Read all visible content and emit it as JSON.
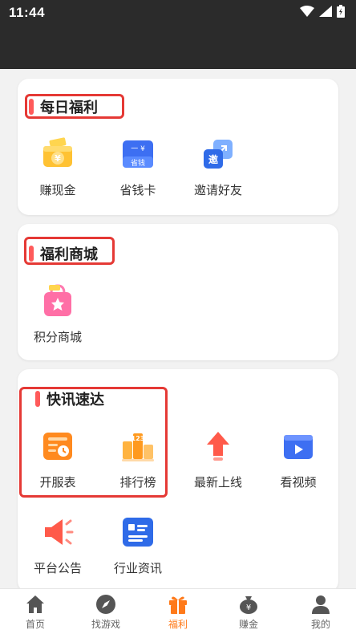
{
  "status_bar": {
    "time": "11:44"
  },
  "sections": [
    {
      "title": "每日福利",
      "items": [
        "赚现金",
        "省钱卡",
        "邀请好友"
      ]
    },
    {
      "title": "福利商城",
      "items": [
        "积分商城"
      ]
    },
    {
      "title": "快讯速达",
      "items": [
        "开服表",
        "排行榜",
        "最新上线",
        "看视频",
        "平台公告",
        "行业资讯"
      ]
    }
  ],
  "icon_text": {
    "cash": "¥",
    "card_top": "一 ¥",
    "card_bottom": "省钱",
    "invite": "邀",
    "rank": "123"
  },
  "tabs": [
    {
      "label": "首页",
      "icon": "home-icon"
    },
    {
      "label": "找游戏",
      "icon": "compass-icon"
    },
    {
      "label": "福利",
      "icon": "gift-icon",
      "active": true
    },
    {
      "label": "赚金",
      "icon": "money-bag-icon"
    },
    {
      "label": "我的",
      "icon": "user-icon"
    }
  ],
  "colors": {
    "accent": "#ff7a1a",
    "highlight": "#e53935",
    "title_bar": "#ff5a5a"
  }
}
